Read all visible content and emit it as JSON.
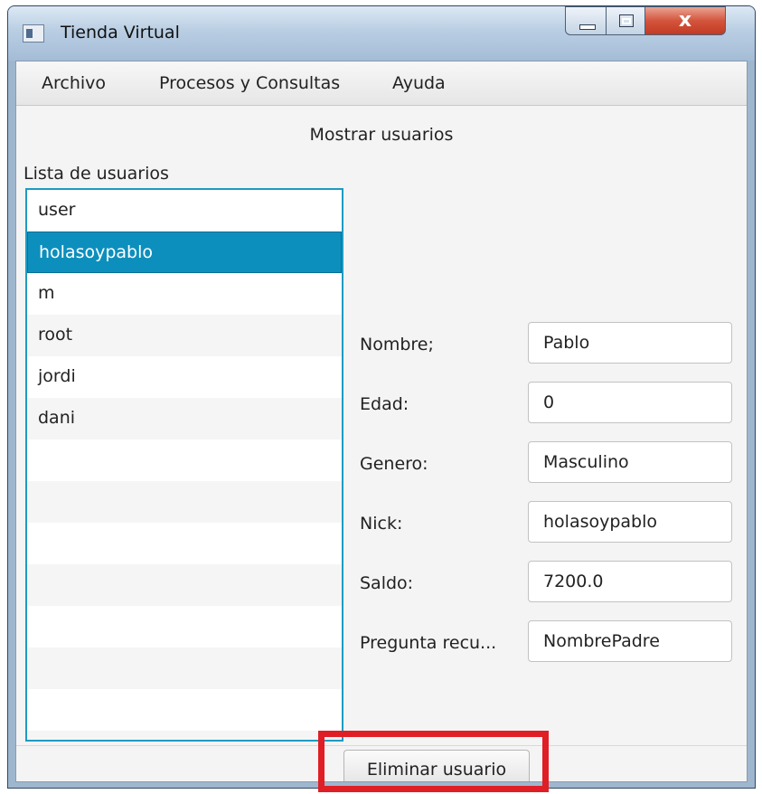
{
  "window": {
    "title": "Tienda Virtual",
    "title_icon": "app-window-icon",
    "controls": {
      "close_glyph": "x"
    }
  },
  "menu": {
    "items": [
      {
        "label": "Archivo"
      },
      {
        "label": "Procesos y Consultas"
      },
      {
        "label": "Ayuda"
      }
    ]
  },
  "main": {
    "heading": "Mostrar usuarios",
    "list_label": "Lista de usuarios",
    "users": [
      "user",
      "holasoypablo",
      "m",
      "root",
      "jordi",
      "dani"
    ],
    "selected_user": "holasoypablo",
    "fields": [
      {
        "label": "Nombre;",
        "value": "Pablo"
      },
      {
        "label": "Edad:",
        "value": "0"
      },
      {
        "label": "Genero:",
        "value": "Masculino"
      },
      {
        "label": "Nick:",
        "value": "holasoypablo"
      },
      {
        "label": "Saldo:",
        "value": "7200.0"
      },
      {
        "label": "Pregunta recu...",
        "value": "NombrePadre"
      }
    ],
    "delete_button": "Eliminar usuario"
  },
  "colors": {
    "selection": "#0d8fbd",
    "list_border": "#1e9bc2",
    "highlight": "#e01e25"
  }
}
